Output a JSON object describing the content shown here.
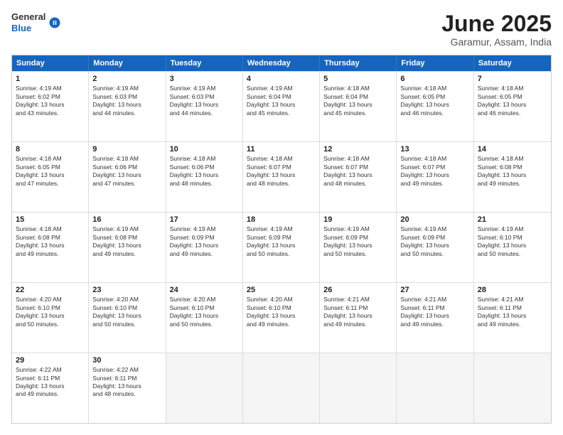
{
  "header": {
    "logo_general": "General",
    "logo_blue": "Blue",
    "title": "June 2025",
    "location": "Garamur, Assam, India"
  },
  "weekdays": [
    "Sunday",
    "Monday",
    "Tuesday",
    "Wednesday",
    "Thursday",
    "Friday",
    "Saturday"
  ],
  "rows": [
    [
      {
        "day": "1",
        "lines": [
          "Sunrise: 4:19 AM",
          "Sunset: 6:02 PM",
          "Daylight: 13 hours",
          "and 43 minutes."
        ]
      },
      {
        "day": "2",
        "lines": [
          "Sunrise: 4:19 AM",
          "Sunset: 6:03 PM",
          "Daylight: 13 hours",
          "and 44 minutes."
        ]
      },
      {
        "day": "3",
        "lines": [
          "Sunrise: 4:19 AM",
          "Sunset: 6:03 PM",
          "Daylight: 13 hours",
          "and 44 minutes."
        ]
      },
      {
        "day": "4",
        "lines": [
          "Sunrise: 4:19 AM",
          "Sunset: 6:04 PM",
          "Daylight: 13 hours",
          "and 45 minutes."
        ]
      },
      {
        "day": "5",
        "lines": [
          "Sunrise: 4:18 AM",
          "Sunset: 6:04 PM",
          "Daylight: 13 hours",
          "and 45 minutes."
        ]
      },
      {
        "day": "6",
        "lines": [
          "Sunrise: 4:18 AM",
          "Sunset: 6:05 PM",
          "Daylight: 13 hours",
          "and 46 minutes."
        ]
      },
      {
        "day": "7",
        "lines": [
          "Sunrise: 4:18 AM",
          "Sunset: 6:05 PM",
          "Daylight: 13 hours",
          "and 46 minutes."
        ]
      }
    ],
    [
      {
        "day": "8",
        "lines": [
          "Sunrise: 4:18 AM",
          "Sunset: 6:05 PM",
          "Daylight: 13 hours",
          "and 47 minutes."
        ]
      },
      {
        "day": "9",
        "lines": [
          "Sunrise: 4:18 AM",
          "Sunset: 6:06 PM",
          "Daylight: 13 hours",
          "and 47 minutes."
        ]
      },
      {
        "day": "10",
        "lines": [
          "Sunrise: 4:18 AM",
          "Sunset: 6:06 PM",
          "Daylight: 13 hours",
          "and 48 minutes."
        ]
      },
      {
        "day": "11",
        "lines": [
          "Sunrise: 4:18 AM",
          "Sunset: 6:07 PM",
          "Daylight: 13 hours",
          "and 48 minutes."
        ]
      },
      {
        "day": "12",
        "lines": [
          "Sunrise: 4:18 AM",
          "Sunset: 6:07 PM",
          "Daylight: 13 hours",
          "and 48 minutes."
        ]
      },
      {
        "day": "13",
        "lines": [
          "Sunrise: 4:18 AM",
          "Sunset: 6:07 PM",
          "Daylight: 13 hours",
          "and 49 minutes."
        ]
      },
      {
        "day": "14",
        "lines": [
          "Sunrise: 4:18 AM",
          "Sunset: 6:08 PM",
          "Daylight: 13 hours",
          "and 49 minutes."
        ]
      }
    ],
    [
      {
        "day": "15",
        "lines": [
          "Sunrise: 4:18 AM",
          "Sunset: 6:08 PM",
          "Daylight: 13 hours",
          "and 49 minutes."
        ]
      },
      {
        "day": "16",
        "lines": [
          "Sunrise: 4:19 AM",
          "Sunset: 6:08 PM",
          "Daylight: 13 hours",
          "and 49 minutes."
        ]
      },
      {
        "day": "17",
        "lines": [
          "Sunrise: 4:19 AM",
          "Sunset: 6:09 PM",
          "Daylight: 13 hours",
          "and 49 minutes."
        ]
      },
      {
        "day": "18",
        "lines": [
          "Sunrise: 4:19 AM",
          "Sunset: 6:09 PM",
          "Daylight: 13 hours",
          "and 50 minutes."
        ]
      },
      {
        "day": "19",
        "lines": [
          "Sunrise: 4:19 AM",
          "Sunset: 6:09 PM",
          "Daylight: 13 hours",
          "and 50 minutes."
        ]
      },
      {
        "day": "20",
        "lines": [
          "Sunrise: 4:19 AM",
          "Sunset: 6:09 PM",
          "Daylight: 13 hours",
          "and 50 minutes."
        ]
      },
      {
        "day": "21",
        "lines": [
          "Sunrise: 4:19 AM",
          "Sunset: 6:10 PM",
          "Daylight: 13 hours",
          "and 50 minutes."
        ]
      }
    ],
    [
      {
        "day": "22",
        "lines": [
          "Sunrise: 4:20 AM",
          "Sunset: 6:10 PM",
          "Daylight: 13 hours",
          "and 50 minutes."
        ]
      },
      {
        "day": "23",
        "lines": [
          "Sunrise: 4:20 AM",
          "Sunset: 6:10 PM",
          "Daylight: 13 hours",
          "and 50 minutes."
        ]
      },
      {
        "day": "24",
        "lines": [
          "Sunrise: 4:20 AM",
          "Sunset: 6:10 PM",
          "Daylight: 13 hours",
          "and 50 minutes."
        ]
      },
      {
        "day": "25",
        "lines": [
          "Sunrise: 4:20 AM",
          "Sunset: 6:10 PM",
          "Daylight: 13 hours",
          "and 49 minutes."
        ]
      },
      {
        "day": "26",
        "lines": [
          "Sunrise: 4:21 AM",
          "Sunset: 6:11 PM",
          "Daylight: 13 hours",
          "and 49 minutes."
        ]
      },
      {
        "day": "27",
        "lines": [
          "Sunrise: 4:21 AM",
          "Sunset: 6:11 PM",
          "Daylight: 13 hours",
          "and 49 minutes."
        ]
      },
      {
        "day": "28",
        "lines": [
          "Sunrise: 4:21 AM",
          "Sunset: 6:11 PM",
          "Daylight: 13 hours",
          "and 49 minutes."
        ]
      }
    ],
    [
      {
        "day": "29",
        "lines": [
          "Sunrise: 4:22 AM",
          "Sunset: 6:11 PM",
          "Daylight: 13 hours",
          "and 49 minutes."
        ]
      },
      {
        "day": "30",
        "lines": [
          "Sunrise: 4:22 AM",
          "Sunset: 6:11 PM",
          "Daylight: 13 hours",
          "and 48 minutes."
        ]
      },
      {
        "day": "",
        "lines": []
      },
      {
        "day": "",
        "lines": []
      },
      {
        "day": "",
        "lines": []
      },
      {
        "day": "",
        "lines": []
      },
      {
        "day": "",
        "lines": []
      }
    ]
  ]
}
